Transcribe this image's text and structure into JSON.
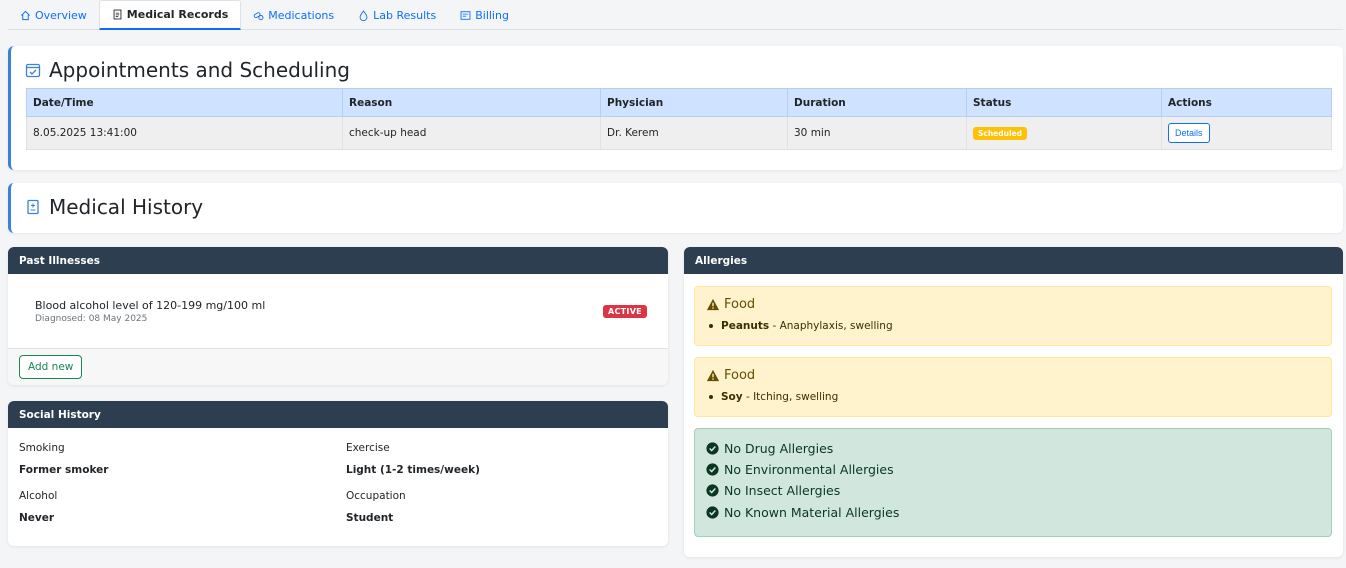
{
  "tabs": [
    {
      "label": "Overview",
      "icon": "home-icon"
    },
    {
      "label": "Medical Records",
      "icon": "document-icon",
      "active": true
    },
    {
      "label": "Medications",
      "icon": "pills-icon"
    },
    {
      "label": "Lab Results",
      "icon": "droplet-icon"
    },
    {
      "label": "Billing",
      "icon": "receipt-icon"
    }
  ],
  "appointments": {
    "title": "Appointments and Scheduling",
    "columns": [
      "Date/Time",
      "Reason",
      "Physician",
      "Duration",
      "Status",
      "Actions"
    ],
    "rows": [
      {
        "datetime": "8.05.2025 13:41:00",
        "reason": "check-up head",
        "physician": "Dr. Kerem",
        "duration": "30 min",
        "status": "Scheduled",
        "action": "Details"
      }
    ]
  },
  "medical_history": {
    "title": "Medical History"
  },
  "past_illnesses": {
    "title": "Past Illnesses",
    "items": [
      {
        "name": "Blood alcohol level of 120-199 mg/100 ml",
        "diagnosed": "Diagnosed: 08 May 2025",
        "status": "ACTIVE"
      }
    ],
    "add_label": "Add new"
  },
  "social_history": {
    "title": "Social History",
    "smoking_label": "Smoking",
    "smoking_value": "Former smoker",
    "exercise_label": "Exercise",
    "exercise_value": "Light (1-2 times/week)",
    "alcohol_label": "Alcohol",
    "alcohol_value": "Never",
    "occupation_label": "Occupation",
    "occupation_value": "Student"
  },
  "allergies": {
    "title": "Allergies",
    "food": [
      {
        "category": "Food",
        "allergen": "Peanuts",
        "reaction": " - Anaphylaxis, swelling"
      },
      {
        "category": "Food",
        "allergen": "Soy",
        "reaction": " - Itching, swelling"
      }
    ],
    "none": [
      "No Drug Allergies",
      "No Environmental Allergies",
      "No Insect Allergies",
      "No Known Material Allergies"
    ]
  },
  "colors": {
    "accent": "#3b82d6",
    "header": "#2c3e50",
    "danger": "#dc3545",
    "warning": "#ffc107",
    "success": "#198754"
  }
}
